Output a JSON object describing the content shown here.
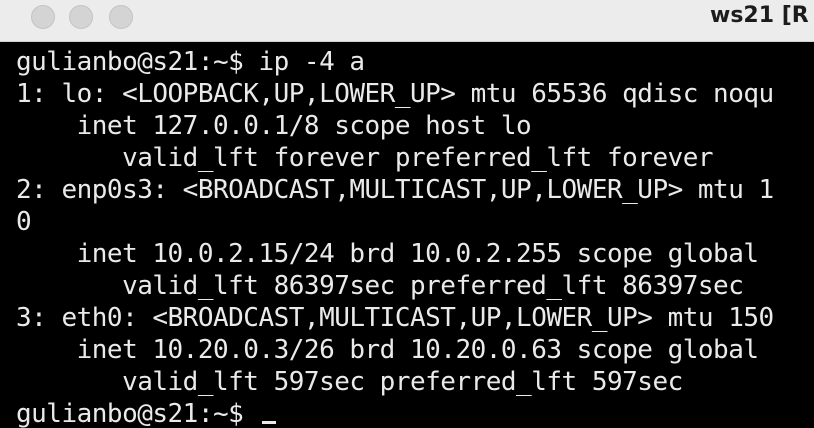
{
  "window": {
    "title": "ws21 [R"
  },
  "terminal": {
    "lines": [
      "gulianbo@s21:~$ ip -4 a",
      "1: lo: <LOOPBACK,UP,LOWER_UP> mtu 65536 qdisc noqu",
      "    inet 127.0.0.1/8 scope host lo",
      "       valid_lft forever preferred_lft forever",
      "2: enp0s3: <BROADCAST,MULTICAST,UP,LOWER_UP> mtu 1",
      "0",
      "    inet 10.0.2.15/24 brd 10.0.2.255 scope global",
      "       valid_lft 86397sec preferred_lft 86397sec",
      "3: eth0: <BROADCAST,MULTICAST,UP,LOWER_UP> mtu 150",
      "    inet 10.20.0.3/26 brd 10.20.0.63 scope global",
      "       valid_lft 597sec preferred_lft 597sec"
    ],
    "prompt": "gulianbo@s21:~$ "
  },
  "colors": {
    "background": "#000000",
    "foreground": "#eaeaea",
    "titlebar": "#ececec"
  }
}
